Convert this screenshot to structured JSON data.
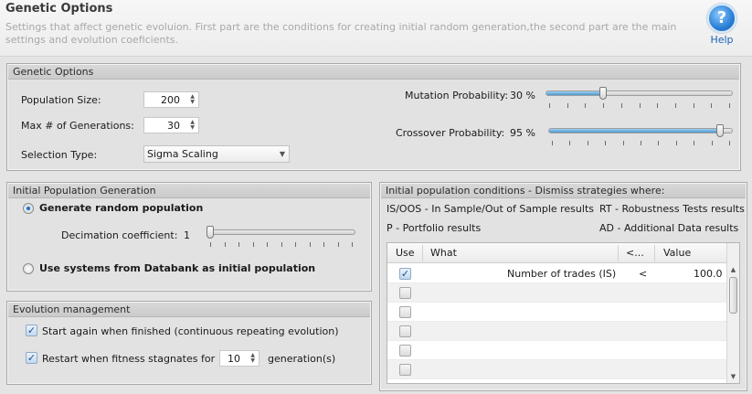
{
  "header": {
    "title": "Genetic Options",
    "description": "Settings that affect genetic evoluion. First part are the conditions for creating initial random generation,the second part are the main settings and evolution coeficients.",
    "help_label": "Help",
    "help_glyph": "?"
  },
  "genetic_options": {
    "title": "Genetic Options",
    "population_size_label": "Population Size:",
    "population_size": "200",
    "max_generations_label": "Max # of Generations:",
    "max_generations": "30",
    "selection_type_label": "Selection Type:",
    "selection_type": "Sigma Scaling",
    "mutation_label": "Mutation Probability:",
    "mutation_value": "30 %",
    "mutation_fraction": 0.3,
    "crossover_label": "Crossover Probability:",
    "crossover_value": "95 %",
    "crossover_fraction": 0.95
  },
  "initial_population": {
    "title": "Initial Population Generation",
    "generate_random_label": "Generate random population",
    "generate_random_checked": true,
    "decimation_label": "Decimation coefficient:",
    "decimation_value": "1",
    "use_databank_label": "Use systems from Databank as initial population",
    "use_databank_checked": false
  },
  "evolution_management": {
    "title": "Evolution management",
    "start_again_label": "Start again when finished (continuous repeating evolution)",
    "start_again_checked": true,
    "restart_label": "Restart when fitness stagnates for",
    "restart_checked": true,
    "stagnation_value": "10",
    "generations_label": "generation(s)"
  },
  "conditions": {
    "title": "Initial population conditions - Dismiss strategies where:",
    "legend_isoos": "IS/OOS - In Sample/Out of Sample results",
    "legend_rt": "RT - Robustness Tests results",
    "legend_p": "P - Portfolio results",
    "legend_ad": "AD - Additional Data results",
    "columns": {
      "use": "Use",
      "what": "What",
      "op": "<...",
      "value": "Value"
    },
    "rows": [
      {
        "checked": true,
        "what": "Number of trades (IS)",
        "op": "<",
        "value": "100.0"
      },
      {
        "checked": false,
        "what": "",
        "op": "",
        "value": ""
      },
      {
        "checked": false,
        "what": "",
        "op": "",
        "value": ""
      },
      {
        "checked": false,
        "what": "",
        "op": "",
        "value": ""
      },
      {
        "checked": false,
        "what": "",
        "op": "",
        "value": ""
      },
      {
        "checked": false,
        "what": "",
        "op": "",
        "value": ""
      },
      {
        "checked": false,
        "what": "",
        "op": "",
        "value": ""
      }
    ]
  },
  "icons": {
    "help": "help-question-icon",
    "spinner": "spinner-arrows-icon",
    "dropdown": "chevron-down-icon",
    "check": "checkmark-icon"
  },
  "colors": {
    "slider_fill": "#4a98cf",
    "help_blue": "#2a7fd6",
    "check_blue": "#1e4f8a"
  }
}
